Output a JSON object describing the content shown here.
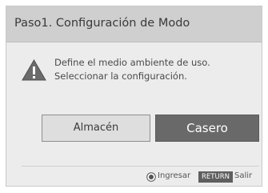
{
  "dialog": {
    "title": "Paso1. Configuración de Modo",
    "message_lines": [
      "Define el medio ambiente de uso.",
      "Seleccionar la configuración."
    ],
    "buttons": {
      "store": "Almacén",
      "home": "Casero"
    },
    "selected_button": "home",
    "footer": {
      "enter_label": "Ingresar",
      "return_key": "RETURN",
      "exit_label": "Salir"
    }
  },
  "icons": {
    "warning": "warning-icon",
    "ok": "ok-button-icon"
  },
  "colors": {
    "title_bar": "#cfcfcf",
    "panel": "#ececec",
    "selected_button": "#696969",
    "unselected_button": "#dedede",
    "return_key": "#5f5f5f"
  }
}
